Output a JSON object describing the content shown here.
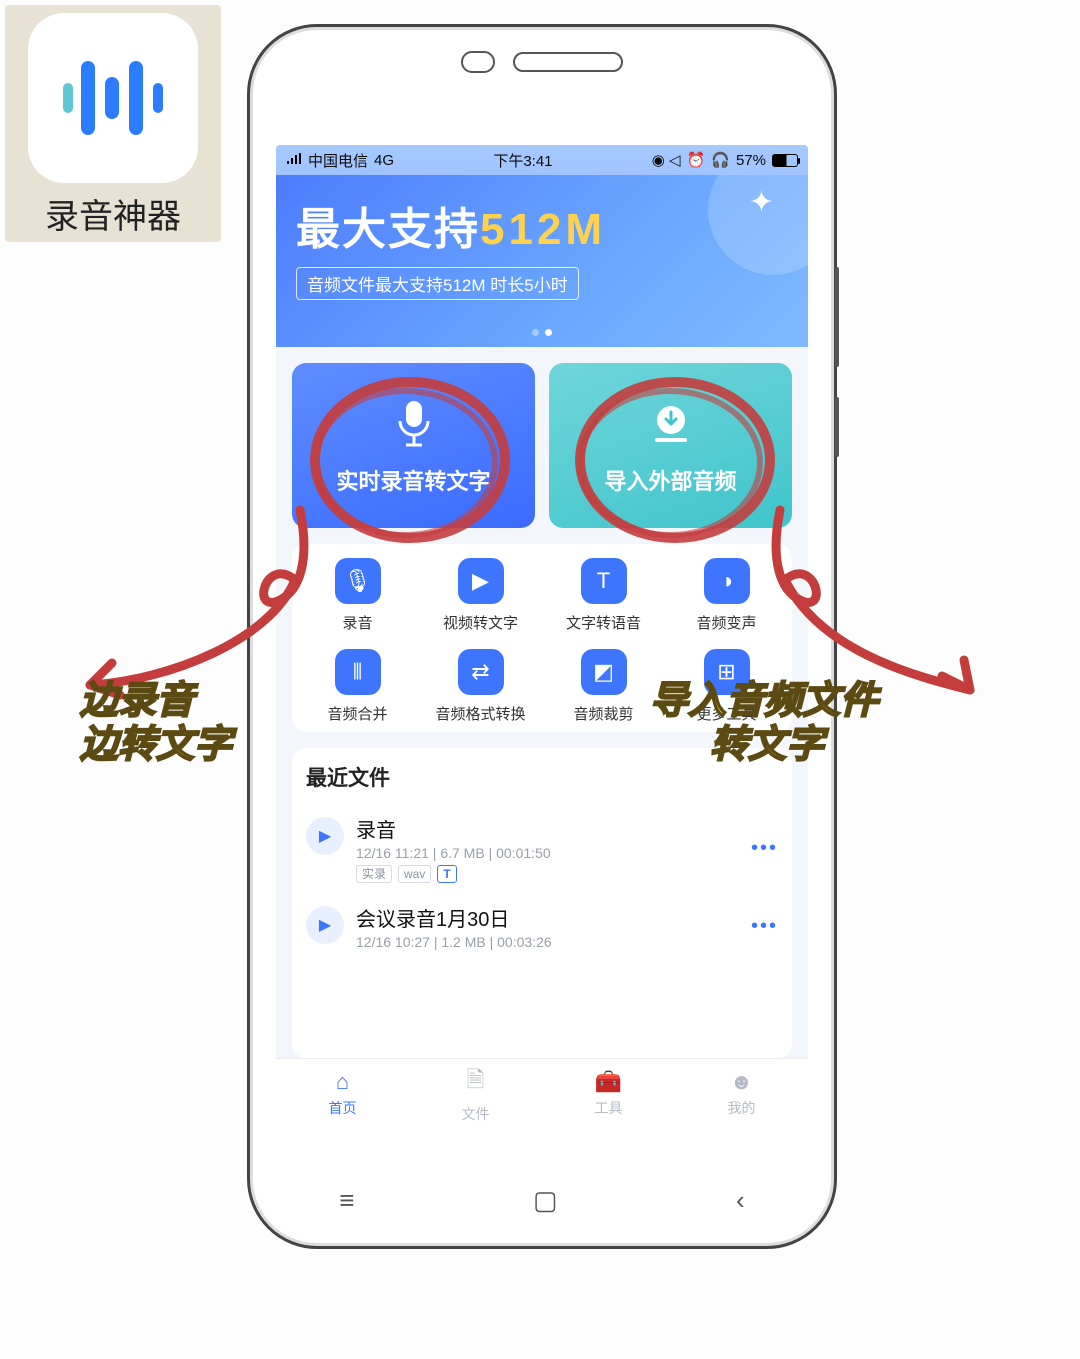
{
  "app_launcher": {
    "name": "录音神器"
  },
  "statusbar": {
    "carrier": "中国电信",
    "network": "4G",
    "time": "下午3:41",
    "battery_pct": "57%"
  },
  "banner": {
    "title_main": "最大支持",
    "title_accent": "512M",
    "subtitle": "音频文件最大支持512M 时长5小时"
  },
  "primary_cards": {
    "record": "实时录音转文字",
    "import": "导入外部音频"
  },
  "tools": [
    {
      "label": "录音"
    },
    {
      "label": "视频转文字"
    },
    {
      "label": "文字转语音"
    },
    {
      "label": "音频变声"
    },
    {
      "label": "音频合并"
    },
    {
      "label": "音频格式转换"
    },
    {
      "label": "音频裁剪"
    },
    {
      "label": "更多工具"
    }
  ],
  "recent": {
    "title": "最近文件",
    "files": [
      {
        "name": "录音",
        "meta": "12/16 11:21 | 6.7 MB | 00:01:50",
        "tags": [
          "实录",
          "wav",
          "T"
        ]
      },
      {
        "name": "会议录音1月30日",
        "meta": "12/16 10:27 | 1.2 MB | 00:03:26",
        "tags": []
      }
    ]
  },
  "bottom_nav": {
    "home": "首页",
    "files": "文件",
    "tools": "工具",
    "me": "我的"
  },
  "annotations": {
    "left_line1": "边录音",
    "left_line2": "边转文字",
    "right_line1": "导入音频文件",
    "right_line2": "转文字"
  }
}
